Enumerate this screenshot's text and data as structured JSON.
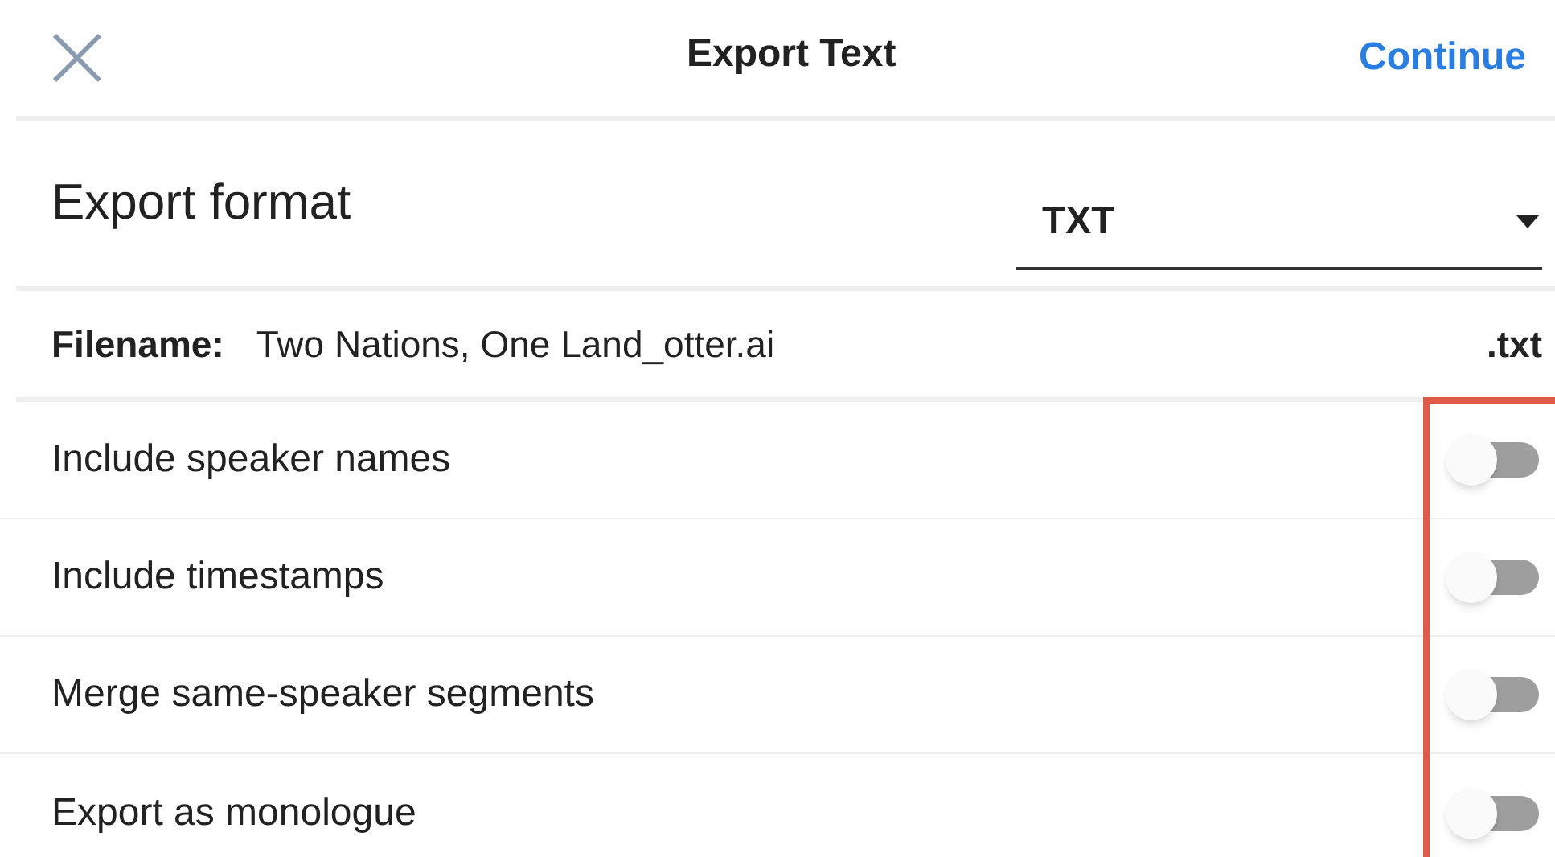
{
  "header": {
    "title": "Export Text",
    "action": "Continue"
  },
  "format": {
    "label": "Export format",
    "value": "TXT"
  },
  "filename": {
    "label": "Filename:",
    "value": "Two Nations, One Land_otter.ai",
    "extension": ".txt"
  },
  "options": [
    {
      "label": "Include speaker names",
      "on": false
    },
    {
      "label": "Include timestamps",
      "on": false
    },
    {
      "label": "Merge same-speaker segments",
      "on": false
    },
    {
      "label": "Export as monologue",
      "on": false
    }
  ]
}
